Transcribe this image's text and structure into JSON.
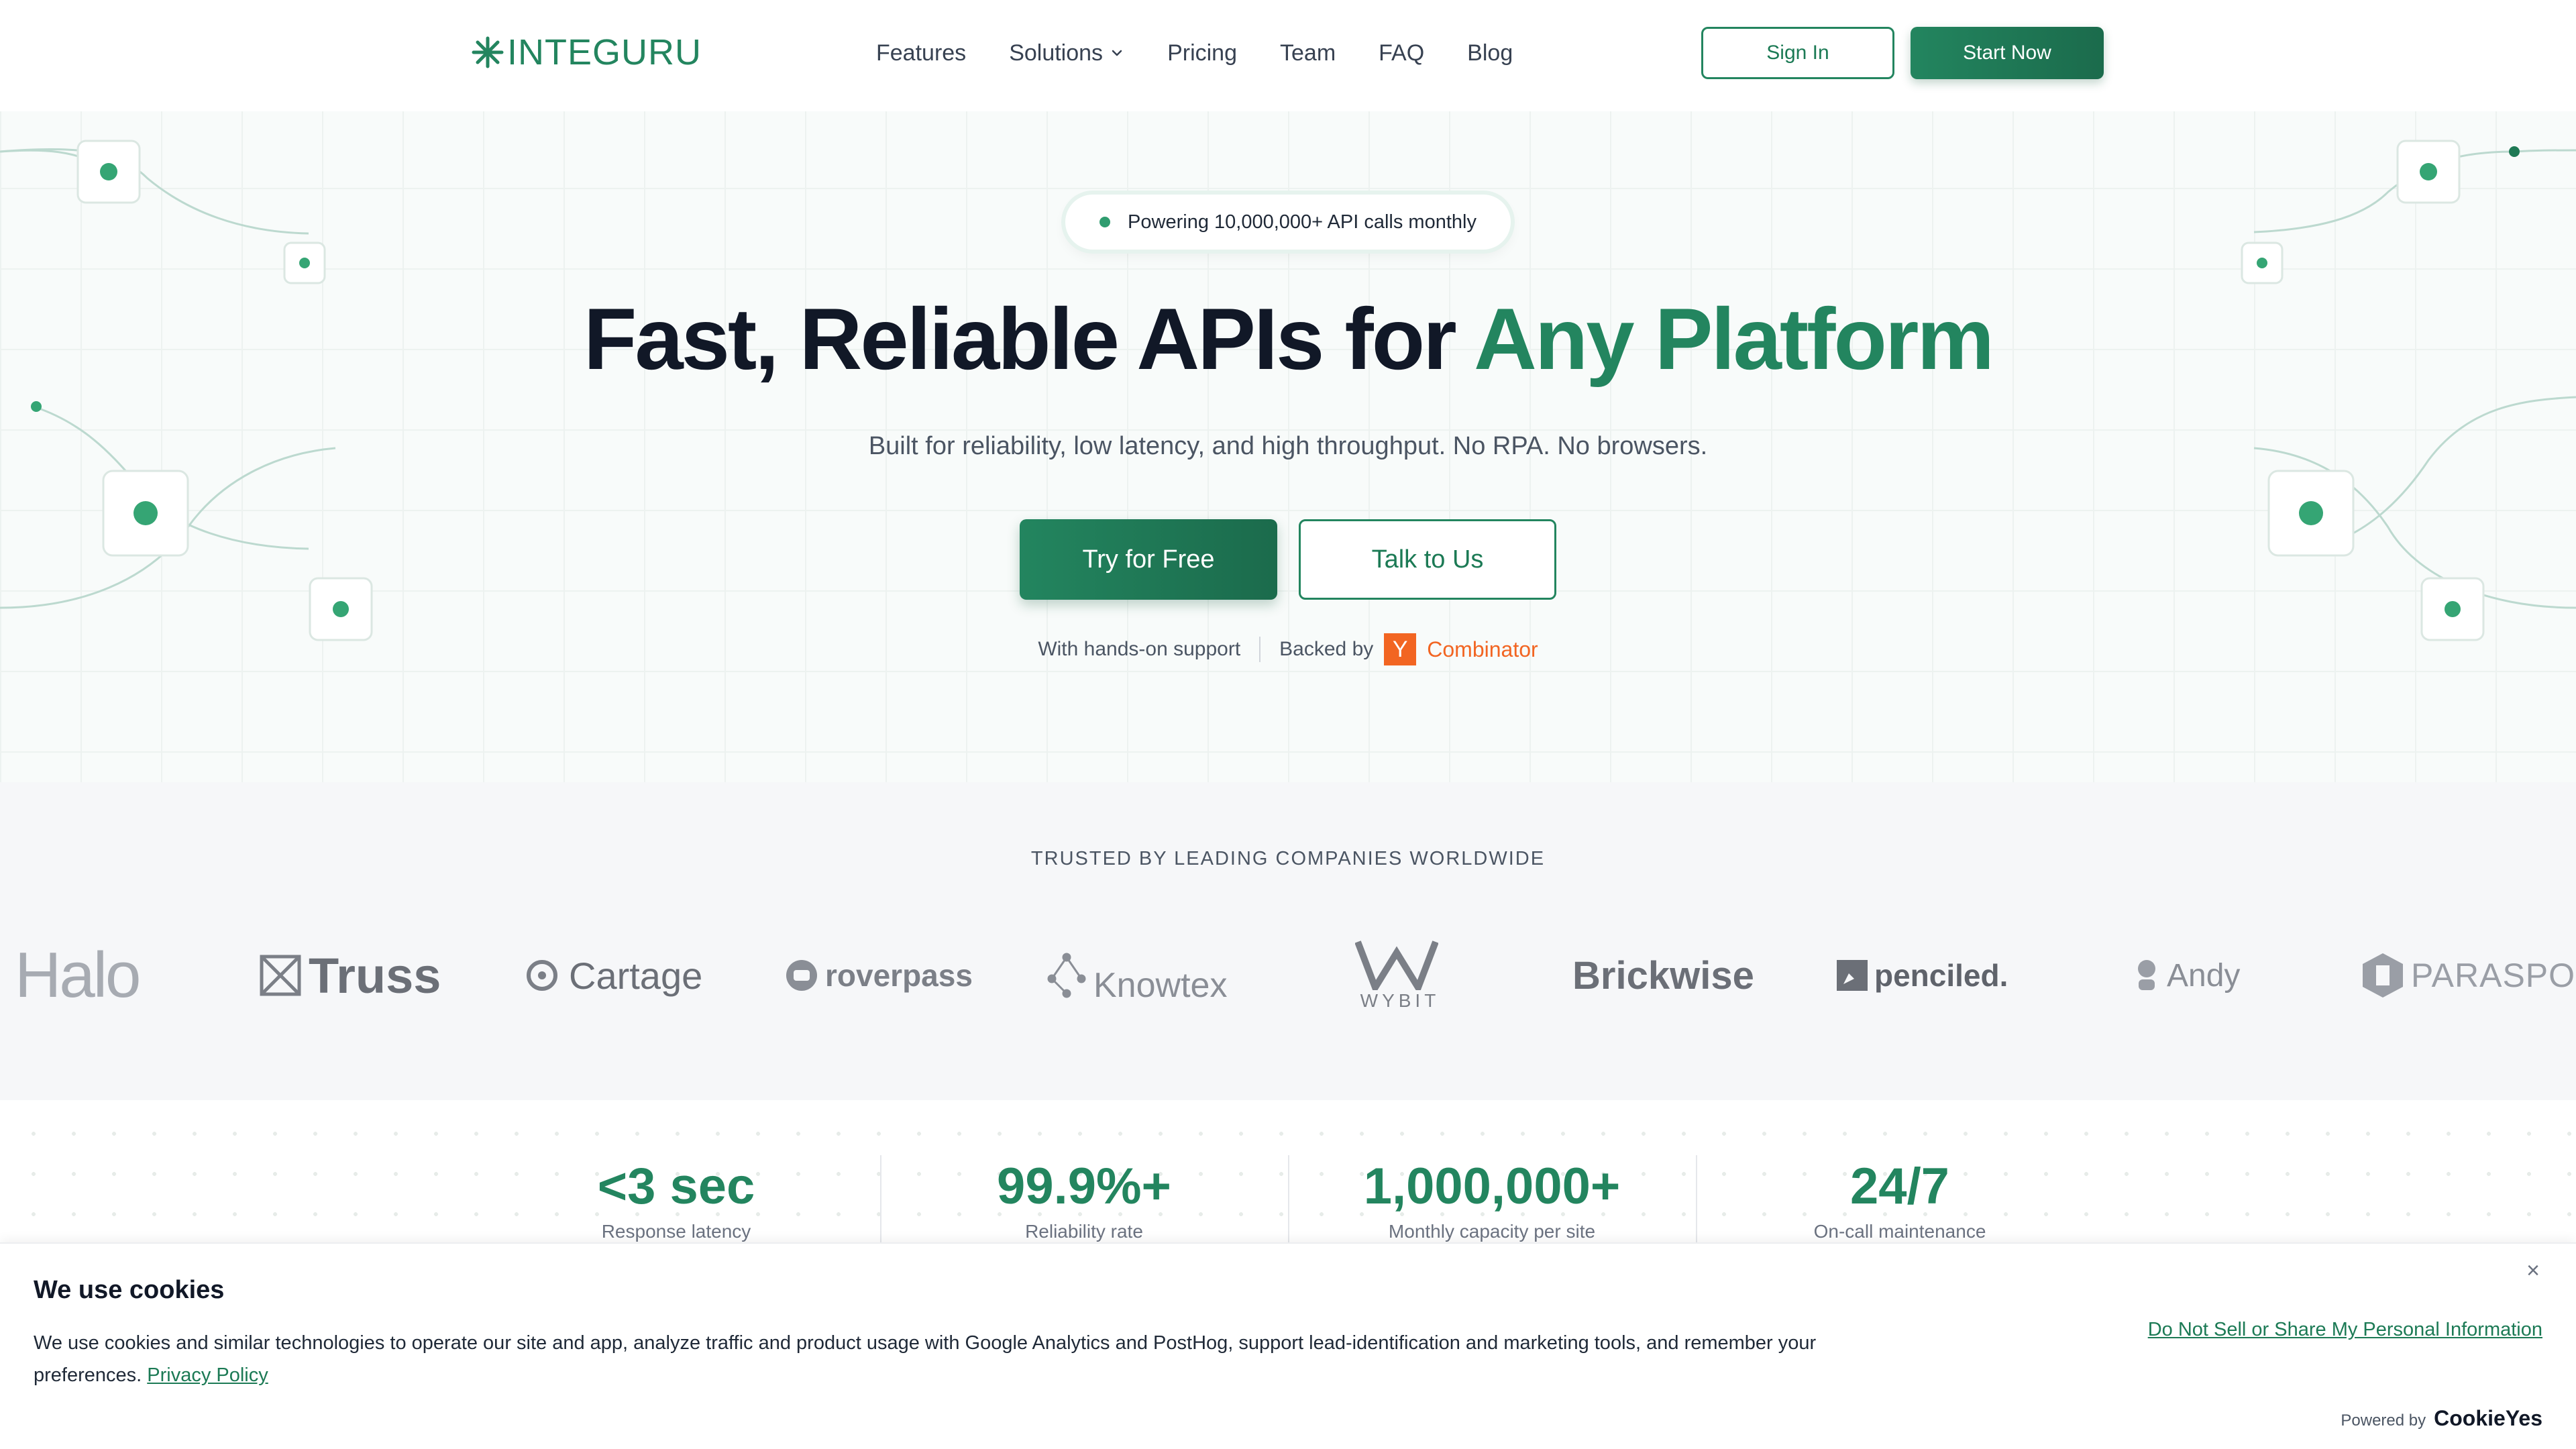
{
  "header": {
    "logo_text": "INTEGURU",
    "nav": [
      "Features",
      "Solutions",
      "Pricing",
      "Team",
      "FAQ",
      "Blog"
    ],
    "sign_in": "Sign In",
    "start_now": "Start Now"
  },
  "hero": {
    "pill": "Powering 10,000,000+ API calls monthly",
    "headline_main": "Fast, Reliable APIs for ",
    "headline_accent": "Any Platform",
    "subhead": "Built for reliability, low latency, and high throughput. No RPA. No browsers.",
    "try_free": "Try for Free",
    "talk_to_us": "Talk to Us",
    "support": "With hands-on support",
    "backed_by": "Backed by",
    "yc_letter": "Y",
    "yc_name": "Combinator"
  },
  "logos": {
    "trusted": "TRUSTED BY LEADING COMPANIES WORLDWIDE",
    "clients": [
      "Halo",
      "Truss",
      "Cartage",
      "roverpass",
      "Knowtex",
      "WYBIT",
      "Brickwise",
      "penciled.",
      "Andy",
      "PARASPOT"
    ]
  },
  "stats": [
    {
      "value": "<3 sec",
      "label": "Response latency"
    },
    {
      "value": "99.9%+",
      "label": "Reliability rate"
    },
    {
      "value": "1,000,000+",
      "label": "Monthly capacity per site"
    },
    {
      "value": "24/7",
      "label": "On-call maintenance"
    }
  ],
  "cookie": {
    "title": "We use cookies",
    "text": "We use cookies and similar technologies to operate our site and app, analyze traffic and product usage with Google Analytics and PostHog, support lead-identification and marketing tools, and remember your preferences.",
    "privacy_link": "Privacy Policy",
    "do_not_sell": "Do Not Sell or Share My Personal Information",
    "close": "×",
    "powered_by": "Powered by",
    "powered_brand": "CookieYes"
  },
  "colors": {
    "brand": "#23855f",
    "yc": "#f26522"
  }
}
